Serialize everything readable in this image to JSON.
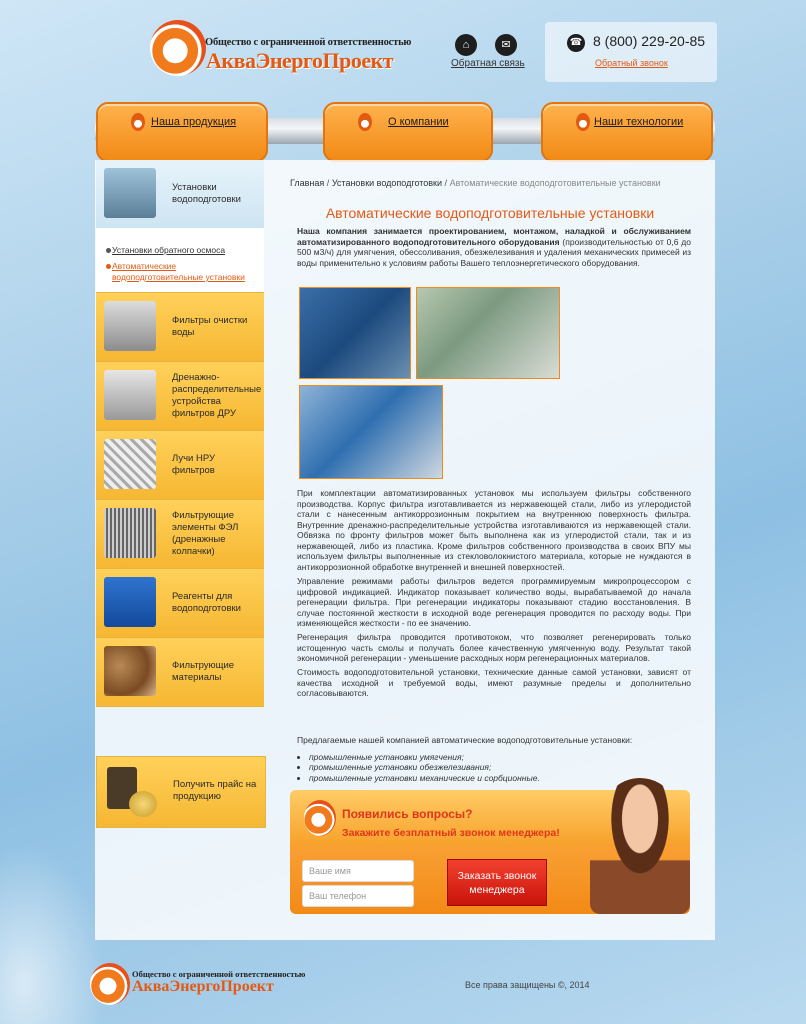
{
  "header": {
    "logo_small": "Общество с ограниченной ответственностью",
    "logo_big": "АкваЭнергоПроект",
    "home_icon": "home-icon",
    "mail_icon": "mail-icon",
    "feedback_link": "Обратная связь",
    "phone": "8 (800) 229-20-85",
    "callback_link": "Обратный звонок"
  },
  "nav": {
    "items": [
      {
        "label": "Наша продукция"
      },
      {
        "label": "О компании"
      },
      {
        "label": "Наши технологии"
      }
    ]
  },
  "sidebar": {
    "active": {
      "label": "Установки водоподготовки"
    },
    "submenu": [
      {
        "label": "Установки обратного осмоса"
      },
      {
        "label": "Автоматические водоподготовительные установки"
      }
    ],
    "items": [
      {
        "label": "Фильтры очистки воды"
      },
      {
        "label": "Дренажно-распределительные устройства фильтров ДРУ"
      },
      {
        "label": "Лучи НРУ фильтров"
      },
      {
        "label": "Фильтрующие элементы ФЭЛ (дренажные колпачки)"
      },
      {
        "label": "Реагенты для водоподготовки"
      },
      {
        "label": "Фильтрующие материалы"
      }
    ],
    "price": {
      "label": "Получить прайс на продукцию"
    }
  },
  "breadcrumb": {
    "home": "Главная",
    "section": "Установки водоподготовки",
    "current": "Автоматические водоподготовительные установки",
    "sep": "/"
  },
  "content": {
    "title": "Автоматические водоподготовительные установки",
    "intro_bold": "Наша компания занимается проектированием, монтажом, наладкой и обслуживанием автоматизированного водоподготовительного оборудования",
    "intro_rest": " (производительностью от 0,6 до 500 м3/ч) для умягчения, обессоливания, обезжелезивания и удаления механических примесей из воды применительно к условиям работы Вашего теплоэнергетического оборудования.",
    "p1": "При комплектации автоматизированных установок мы используем фильтры собственного производства. Корпус фильтра изготавливается из нержавеющей стали, либо из углеродистой стали с нанесенным антикоррозионным покрытием на внутреннюю поверхность фильтра. Внутренние дренажно-распределительные устройства изготавливаются из нержавеющей стали. Обвязка по фронту фильтров может быть выполнена как из углеродистой стали, так и из нержавеющей, либо из пластика. Кроме фильтров собственного производства в своих ВПУ мы используем фильтры выполненные из стекловолокнистого материала, которые не нуждаются в антикоррозионной обработке внутренней и внешней поверхностей.",
    "p2": "Управление режимами работы фильтров ведется программируемым микропроцессором с цифровой индикацией. Индикатор показывает количество воды, вырабатываемой до начала регенерации фильтра. При регенерации индикаторы показывают стадию восстановления. В случае постоянной жесткости в исходной воде регенерация проводится по расходу воды. При изменяющейся жесткости - по ее значению.",
    "p3": "Регенерация фильтра проводится противотоком, что позволяет регенерировать только истощенную часть смолы и получать более качественную умягченную воду. Результат такой экономичной регенерации - уменьшение расходных норм регенерационных материалов.",
    "p4": "Стоимость водоподготовительной установки, технические данные самой установки, зависят от качества исходной и требуемой воды, имеют разумные пределы и дополнительно согласовываются.",
    "list_intro": "Предлагаемые нашей компанией автоматические водоподготовительные установки:",
    "list": [
      "промышленные установки умягчения;",
      "промышленные установки обезжелезивания;",
      "промышленные установки механические и сорбционные."
    ]
  },
  "callback_form": {
    "question": "Появились вопросы?",
    "offer": "Закажите безплатный звонок менеджера!",
    "name_placeholder": "Ваше имя",
    "phone_placeholder": "Ваш телефон",
    "button": "Заказать звонок менеджера"
  },
  "footer": {
    "logo_small": "Общество с ограниченной ответственностью",
    "logo_big": "АкваЭнергоПроект",
    "copyright": "Все права защищены ©, 2014"
  }
}
